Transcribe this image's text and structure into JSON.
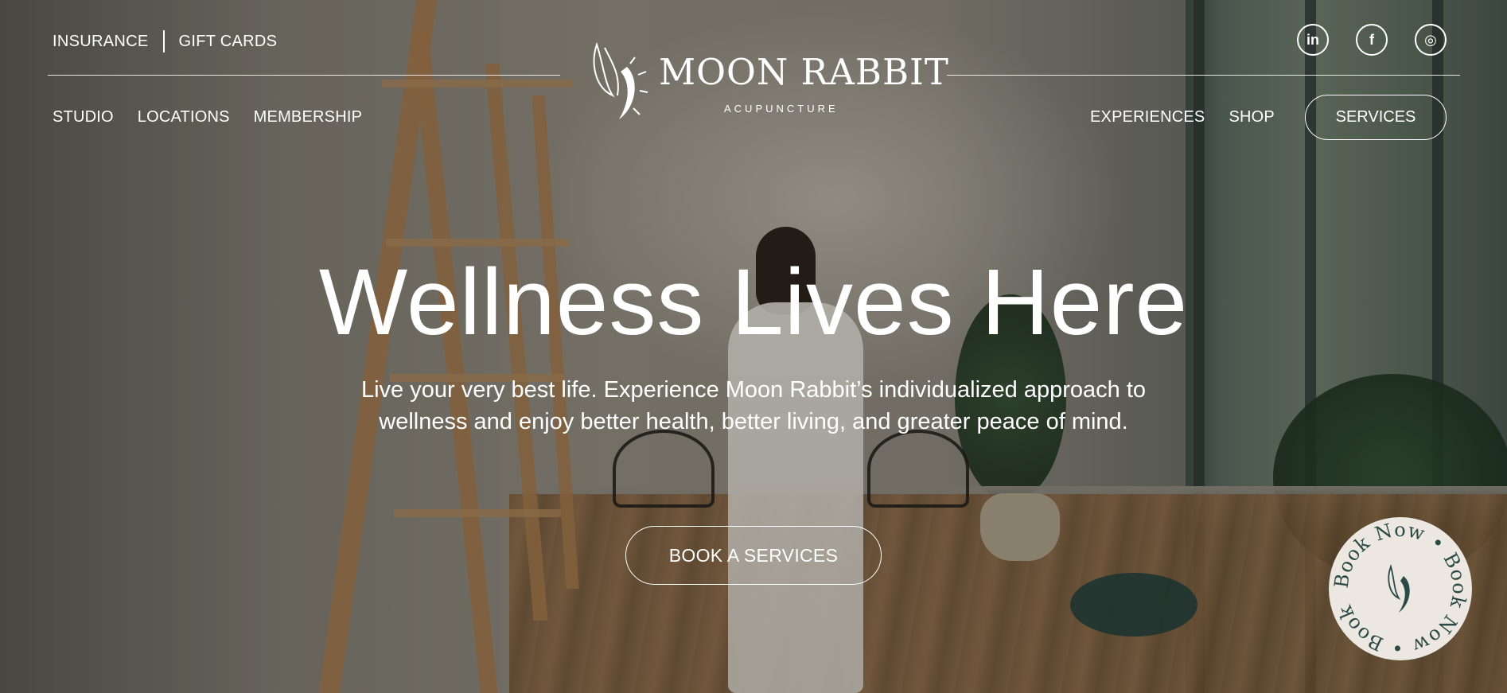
{
  "top_links": {
    "insurance": "INSURANCE",
    "gift_cards": "GIFT CARDS"
  },
  "nav_left": [
    "STUDIO",
    "LOCATIONS",
    "MEMBERSHIP"
  ],
  "nav_right": [
    "EXPERIENCES",
    "SHOP"
  ],
  "services_button": "SERVICES",
  "logo": {
    "name": "MOON RABBIT",
    "subtitle": "ACUPUNCTURE"
  },
  "social": [
    {
      "icon": "linkedin-icon",
      "glyph": "in"
    },
    {
      "icon": "facebook-icon",
      "glyph": "f"
    },
    {
      "icon": "instagram-icon",
      "glyph": "◎"
    }
  ],
  "hero": {
    "headline": "Wellness Lives Here",
    "subtext": "Live your very best life. Experience Moon Rabbit’s individualized approach to wellness and enjoy better health, better living, and greater peace of mind.",
    "cta": "BOOK A SERVICES"
  },
  "book_now_badge": {
    "text": "Book Now • Book Now • Book Now •"
  }
}
